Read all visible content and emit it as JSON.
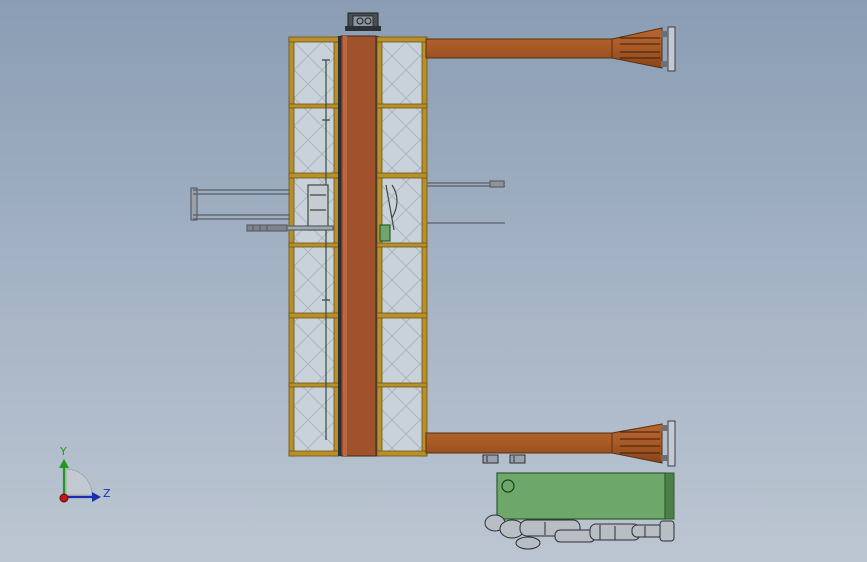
{
  "view": {
    "background_top": "#8a9db4",
    "background_bottom": "#bcc6d2"
  },
  "model": {
    "frame_color": "#b8902a",
    "frame_dark": "#6e5418",
    "column_color": "#a0522d",
    "beam_color": "#a85a26",
    "beam_dark": "#5a3010",
    "panel_color": "#c9d1da",
    "plate_color": "#c4cad2",
    "machine_color": "#6da86a",
    "machine_dark": "#2f5a2d",
    "figure_color": "#b9bec4",
    "rod_color": "#8d939a"
  },
  "triad": {
    "y_label": "Y",
    "z_label": "Z",
    "y_color": "#1f9a1f",
    "z_color": "#1a2fb0",
    "x_color": "#c01818"
  }
}
